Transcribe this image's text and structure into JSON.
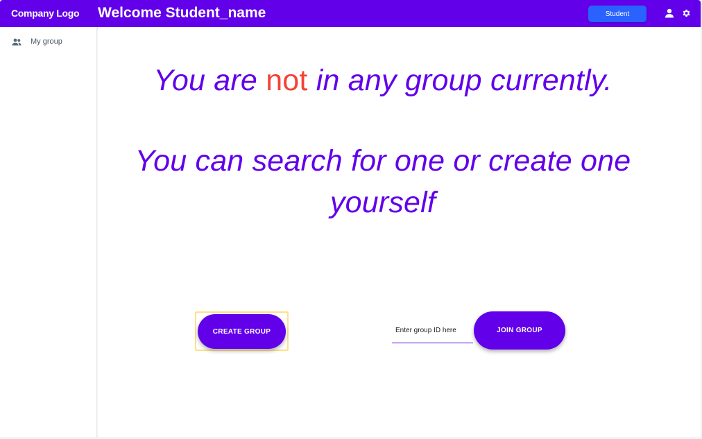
{
  "header": {
    "logo_text": "Company Logo",
    "welcome_text": "Welcome Student_name",
    "role_button": "Student",
    "icons": [
      "account-icon",
      "gear-icon"
    ]
  },
  "sidebar": {
    "items": [
      {
        "label": "My group",
        "icon": "group-icon"
      }
    ]
  },
  "main": {
    "message_line1_before": "You are ",
    "message_line1_highlight": "not",
    "message_line1_after": " in any group currently.",
    "message_line2": "You can search for one or create one yourself",
    "create_button": "CREATE GROUP",
    "group_id_placeholder": "Enter group ID here",
    "join_button": "JOIN GROUP"
  },
  "colors": {
    "primary": "#6200ea",
    "accent_blue": "#2962ff",
    "negative": "#f44336"
  }
}
